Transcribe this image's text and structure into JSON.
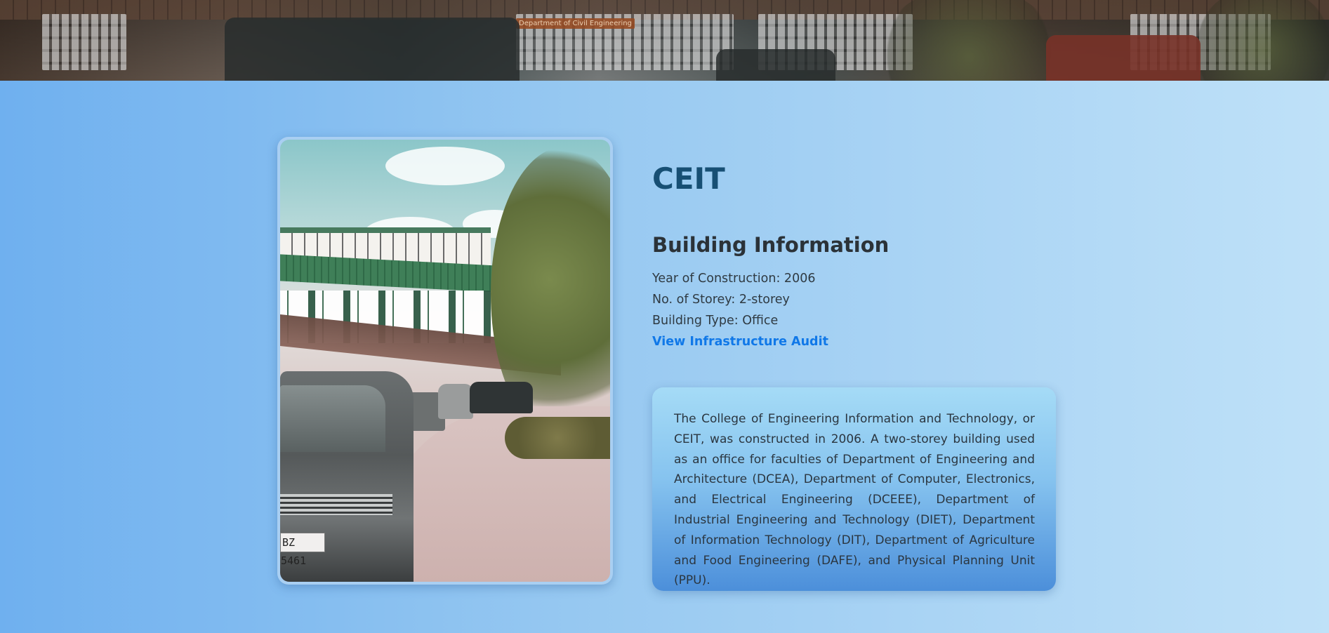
{
  "banner": {
    "sign_text": "Department of Civil Engineering"
  },
  "photo": {
    "plate_text": "BZ 5461"
  },
  "building": {
    "name": "CEIT",
    "info_heading": "Building Information",
    "year_of_construction": "Year of Construction: 2006",
    "storeys": "No. of Storey: 2-storey",
    "building_type": "Building Type: Office",
    "audit_link_label": "View Infrastructure Audit",
    "description": "The College of Engineering Information and Technology, or CEIT, was constructed in 2006. A two-storey building used as an office for faculties of Department of Engineering and Architecture (DCEA), Department of Computer, Electronics, and Electrical Engineering (DCEEE), Department of Industrial Engineering and Technology (DIET), Department of Information Technology (DIT), Department of Agriculture and Food Engineering (DAFE), and Physical Planning Unit (PPU)."
  },
  "colors": {
    "title": "#174f74",
    "link": "#1078e8",
    "background_start": "#6fb0ef",
    "background_end": "#bfe1f8"
  }
}
